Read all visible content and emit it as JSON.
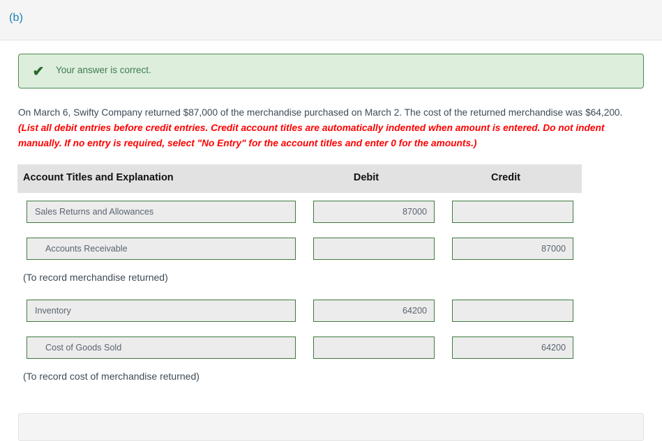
{
  "part": {
    "label": "(b)"
  },
  "alert": {
    "icon": "check-icon",
    "message": "Your answer is correct.",
    "bg_color": "#ddeedd",
    "border_color": "#4a8a4a",
    "text_color": "#3f7a4f"
  },
  "narrative": {
    "plain_text": "On March 6, Swifty Company returned $87,000 of the merchandise purchased on March 2. The cost of the returned merchandise was $64,200. ",
    "emphasis_text": "(List all debit entries before credit entries. Credit account titles are automatically indented when amount is entered. Do not indent manually. If no entry is required, select \"No Entry\" for the account titles and enter 0 for the amounts.)",
    "emphasis_color": "#ff0000"
  },
  "journal": {
    "headers": {
      "account": "Account Titles and Explanation",
      "debit": "Debit",
      "credit": "Credit"
    },
    "rows": [
      {
        "account": "Sales Returns and Allowances",
        "debit": "87000",
        "credit": "",
        "indented": false
      },
      {
        "account": "Accounts Receivable",
        "debit": "",
        "credit": "87000",
        "indented": true
      }
    ],
    "caption_1": "(To record merchandise returned)",
    "rows2": [
      {
        "account": "Inventory",
        "debit": "64200",
        "credit": "",
        "indented": false
      },
      {
        "account": "Cost of Goods Sold",
        "debit": "",
        "credit": "64200",
        "indented": true
      }
    ],
    "caption_2": "(To record cost of merchandise returned)"
  }
}
